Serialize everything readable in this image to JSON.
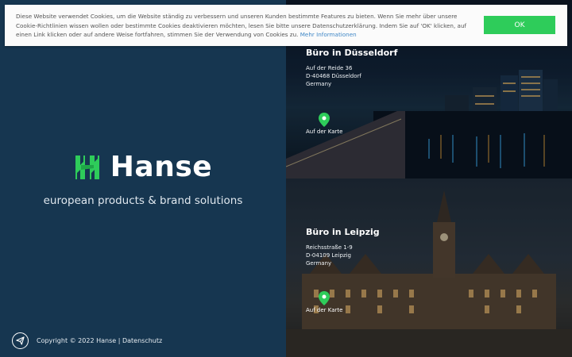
{
  "cookie_banner": {
    "text": "Diese Website verwendet Cookies, um die Website ständig zu verbessern und unseren Kunden bestimmte Features zu bieten. Wenn Sie mehr über unsere Cookie-Richtlinien wissen wollen oder bestimmte Cookies deaktivieren möchten, lesen Sie bitte unsere Datenschutzerklärung. Indem Sie auf 'OK' klicken, auf einen Link klicken oder auf andere Weise fortfahren, stimmen Sie der Verwendung von Cookies zu.",
    "more_link": "Mehr Informationen",
    "ok_label": "OK"
  },
  "brand": {
    "name": "Hanse",
    "tagline": "european products & brand solutions"
  },
  "footer": {
    "copyright": "Copyright © 2022 Hanse",
    "separator": "|",
    "privacy_link": "Datenschutz"
  },
  "offices": [
    {
      "title": "Büro in Düsseldorf",
      "address": [
        "Auf der Reide 36",
        "D-40468 Düsseldorf",
        "Germany"
      ],
      "map_label": "Auf der Karte"
    },
    {
      "title": "Büro in Leipzig",
      "address": [
        "Reichsstraße 1-9",
        "D-04109 Leipzig",
        "Germany"
      ],
      "map_label": "Auf der Karte"
    }
  ],
  "colors": {
    "left_panel": "#163650",
    "accent_green": "#2ecc5a",
    "link_blue": "#3f87c6"
  },
  "icons": {
    "send": "send-icon",
    "pin": "map-pin-icon",
    "logo": "hanse-logo-icon"
  }
}
